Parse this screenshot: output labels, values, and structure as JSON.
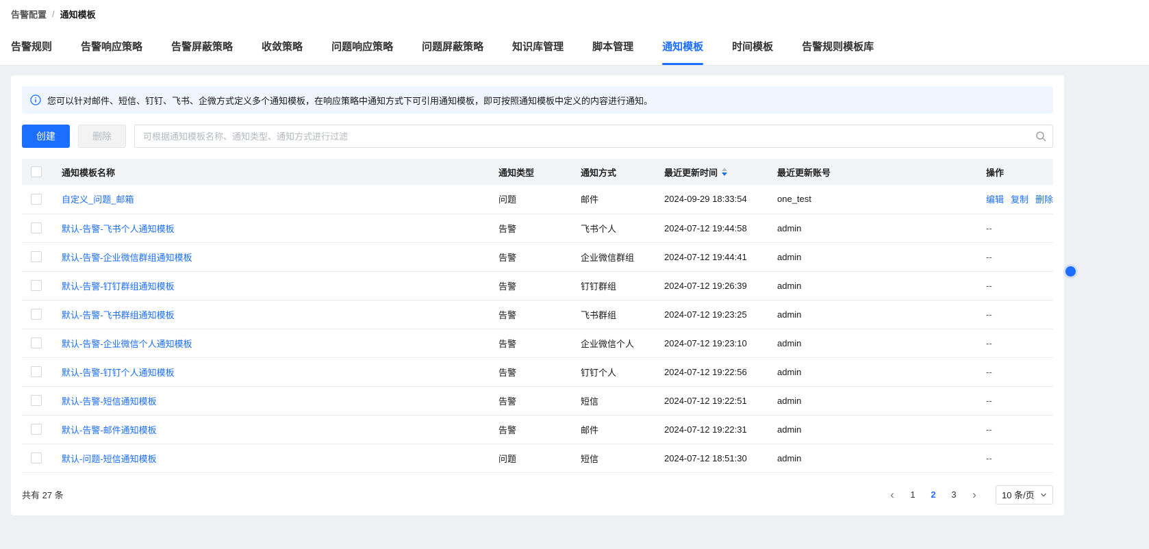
{
  "breadcrumb": {
    "parent": "告警配置",
    "separator": "/",
    "current": "通知模板"
  },
  "tabs": [
    {
      "label": "告警规则",
      "active": false
    },
    {
      "label": "告警响应策略",
      "active": false
    },
    {
      "label": "告警屏蔽策略",
      "active": false
    },
    {
      "label": "收敛策略",
      "active": false
    },
    {
      "label": "问题响应策略",
      "active": false
    },
    {
      "label": "问题屏蔽策略",
      "active": false
    },
    {
      "label": "知识库管理",
      "active": false
    },
    {
      "label": "脚本管理",
      "active": false
    },
    {
      "label": "通知模板",
      "active": true
    },
    {
      "label": "时间模板",
      "active": false
    },
    {
      "label": "告警规则模板库",
      "active": false
    }
  ],
  "banner": {
    "text": "您可以针对邮件、短信、钉钉、飞书、企微方式定义多个通知模板，在响应策略中通知方式下可引用通知模板，即可按照通知模板中定义的内容进行通知。"
  },
  "toolbar": {
    "create_label": "创建",
    "delete_label": "删除",
    "search_placeholder": "可根据通知模板名称、通知类型、通知方式进行过滤"
  },
  "table": {
    "columns": [
      "通知模板名称",
      "通知类型",
      "通知方式",
      "最近更新时间",
      "最近更新账号",
      "操作"
    ],
    "sort_column_index": 3,
    "rows": [
      {
        "name": "自定义_问题_邮箱",
        "type": "问题",
        "method": "邮件",
        "updated": "2024-09-29 18:33:54",
        "account": "one_test",
        "actions": [
          "编辑",
          "复制",
          "删除"
        ]
      },
      {
        "name": "默认-告警-飞书个人通知模板",
        "type": "告警",
        "method": "飞书个人",
        "updated": "2024-07-12 19:44:58",
        "account": "admin",
        "actions": "--"
      },
      {
        "name": "默认-告警-企业微信群组通知模板",
        "type": "告警",
        "method": "企业微信群组",
        "updated": "2024-07-12 19:44:41",
        "account": "admin",
        "actions": "--"
      },
      {
        "name": "默认-告警-钉钉群组通知模板",
        "type": "告警",
        "method": "钉钉群组",
        "updated": "2024-07-12 19:26:39",
        "account": "admin",
        "actions": "--"
      },
      {
        "name": "默认-告警-飞书群组通知模板",
        "type": "告警",
        "method": "飞书群组",
        "updated": "2024-07-12 19:23:25",
        "account": "admin",
        "actions": "--"
      },
      {
        "name": "默认-告警-企业微信个人通知模板",
        "type": "告警",
        "method": "企业微信个人",
        "updated": "2024-07-12 19:23:10",
        "account": "admin",
        "actions": "--"
      },
      {
        "name": "默认-告警-钉钉个人通知模板",
        "type": "告警",
        "method": "钉钉个人",
        "updated": "2024-07-12 19:22:56",
        "account": "admin",
        "actions": "--"
      },
      {
        "name": "默认-告警-短信通知模板",
        "type": "告警",
        "method": "短信",
        "updated": "2024-07-12 19:22:51",
        "account": "admin",
        "actions": "--"
      },
      {
        "name": "默认-告警-邮件通知模板",
        "type": "告警",
        "method": "邮件",
        "updated": "2024-07-12 19:22:31",
        "account": "admin",
        "actions": "--"
      },
      {
        "name": "默认-问题-短信通知模板",
        "type": "问题",
        "method": "短信",
        "updated": "2024-07-12 18:51:30",
        "account": "admin",
        "actions": "--"
      }
    ]
  },
  "pagination": {
    "total_text": "共有 27 条",
    "prev_icon": "‹",
    "next_icon": "›",
    "pages": [
      "1",
      "2",
      "3"
    ],
    "active_page": "2",
    "page_size": "10 条/页"
  },
  "icons": {
    "info": "info-icon",
    "search": "search-icon",
    "sort": "sort-caret-icon",
    "select_chevron": "chevron-down-icon"
  },
  "colors": {
    "accent": "#1c6eff",
    "banner_bg": "#f0f6ff",
    "table_header_bg": "#f3f4f6",
    "disabled_text": "#b9bdc3"
  }
}
